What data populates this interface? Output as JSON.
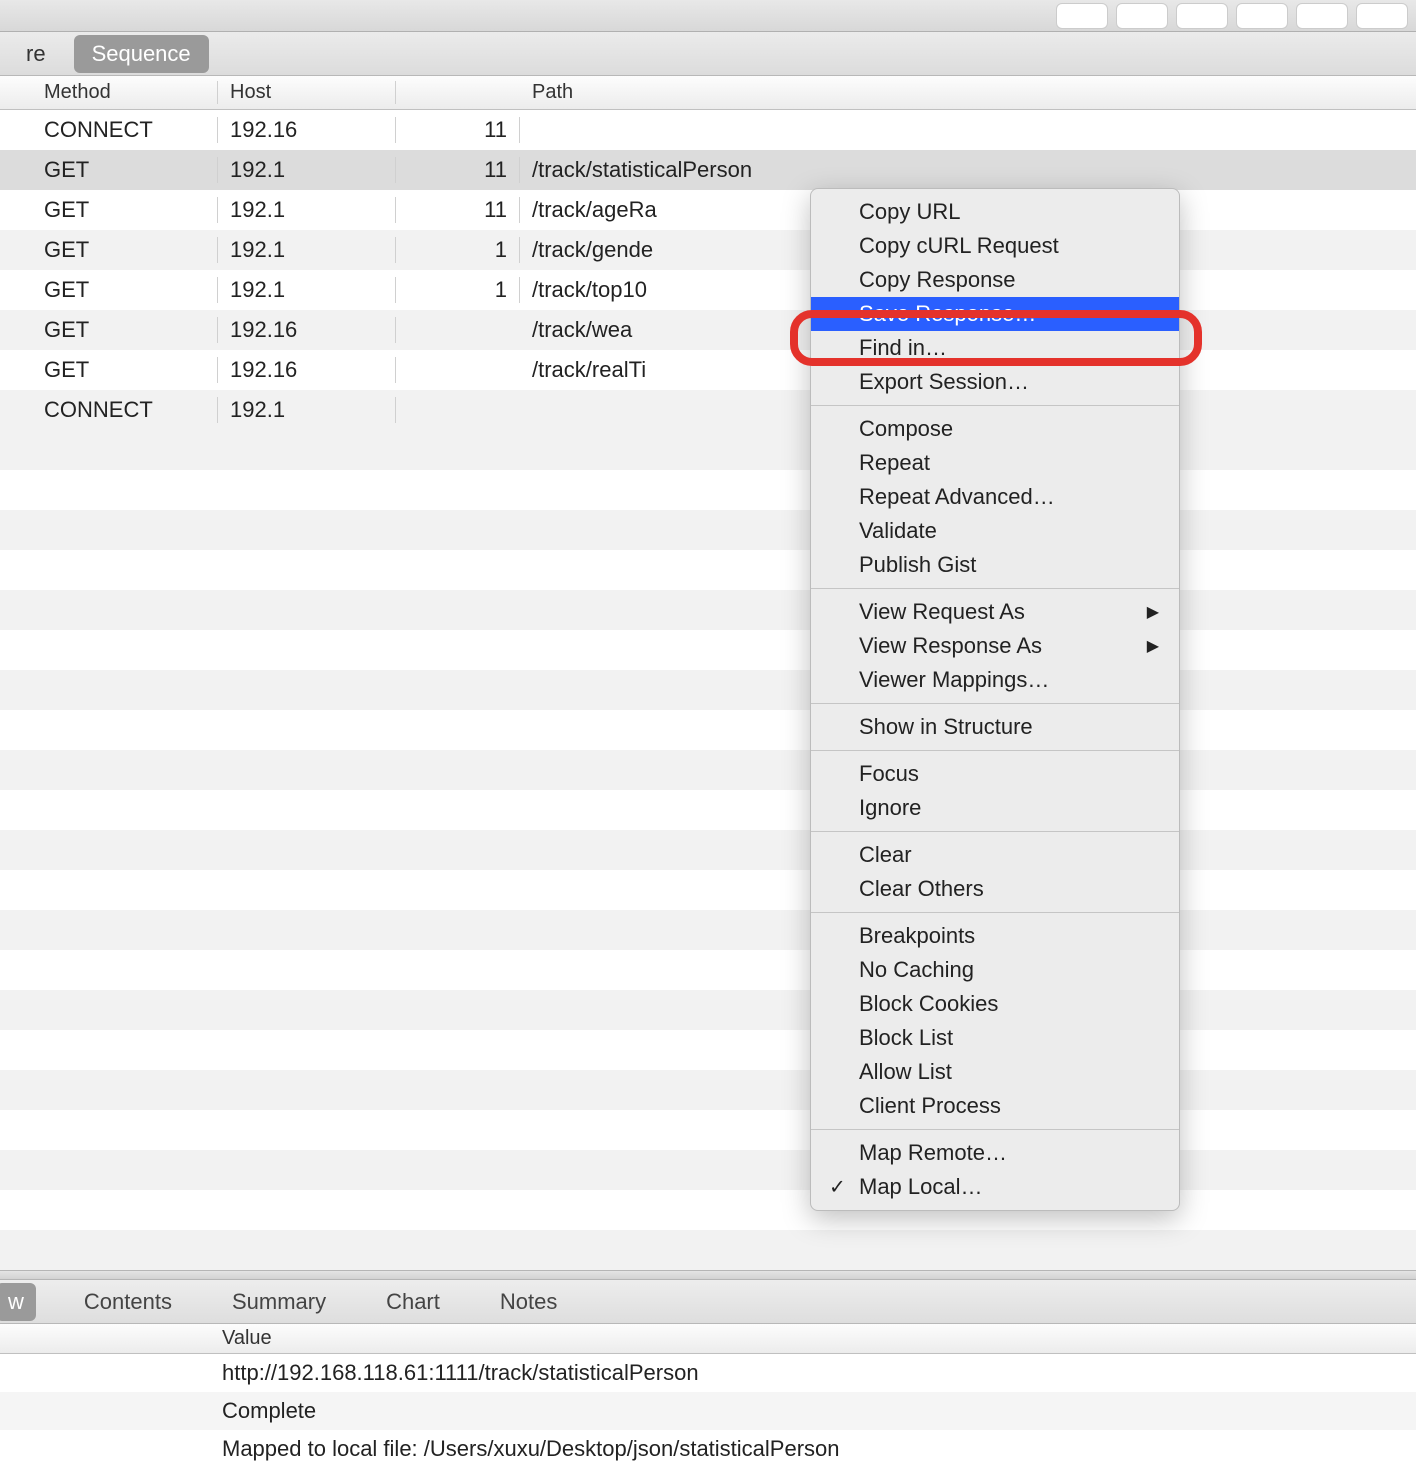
{
  "toolbar": {
    "buttons": 6
  },
  "tabs": {
    "inactive_label": "re",
    "active_label": "Sequence"
  },
  "table": {
    "col_method": "Method",
    "col_host": "Host",
    "col_path": "Path",
    "rows": [
      {
        "method": "CONNECT",
        "host": "192.16",
        "port": "11",
        "path": ""
      },
      {
        "method": "GET",
        "host": "192.1",
        "port": "11",
        "path": "/track/statisticalPerson",
        "selected": true
      },
      {
        "method": "GET",
        "host": "192.1",
        "port": "11",
        "path": "/track/ageRa"
      },
      {
        "method": "GET",
        "host": "192.1",
        "port": "1",
        "path": "/track/gende"
      },
      {
        "method": "GET",
        "host": "192.1",
        "port": "1",
        "path": "/track/top10"
      },
      {
        "method": "GET",
        "host": "192.16",
        "port": "",
        "path": "/track/wea"
      },
      {
        "method": "GET",
        "host": "192.16",
        "port": "",
        "path": "/track/realTi"
      },
      {
        "method": "CONNECT",
        "host": "192.1",
        "port": "",
        "path": ""
      }
    ]
  },
  "context_menu": {
    "groups": [
      [
        "Copy URL",
        "Copy cURL Request",
        "Copy Response",
        "Save Response…",
        "Find in…",
        "Export Session…"
      ],
      [
        "Compose",
        "Repeat",
        "Repeat Advanced…",
        "Validate",
        "Publish Gist"
      ],
      [
        "View Request As",
        "View Response As",
        "Viewer Mappings…"
      ],
      [
        "Show in Structure"
      ],
      [
        "Focus",
        "Ignore"
      ],
      [
        "Clear",
        "Clear Others"
      ],
      [
        "Breakpoints",
        "No Caching",
        "Block Cookies",
        "Block List",
        "Allow List",
        "Client Process"
      ],
      [
        "Map Remote…",
        "Map Local…"
      ]
    ],
    "highlighted": "Save Response…",
    "submenu_items": [
      "View Request As",
      "View Response As"
    ],
    "checked": "Map Local…"
  },
  "bottom_tabs": {
    "active": "w",
    "others": [
      "Contents",
      "Summary",
      "Chart",
      "Notes"
    ]
  },
  "detail": {
    "col_value": "Value",
    "rows": [
      {
        "value": "http://192.168.118.61:1111/track/statisticalPerson"
      },
      {
        "value": "Complete"
      },
      {
        "value": "Mapped to local file: /Users/xuxu/Desktop/json/statisticalPerson"
      }
    ]
  }
}
